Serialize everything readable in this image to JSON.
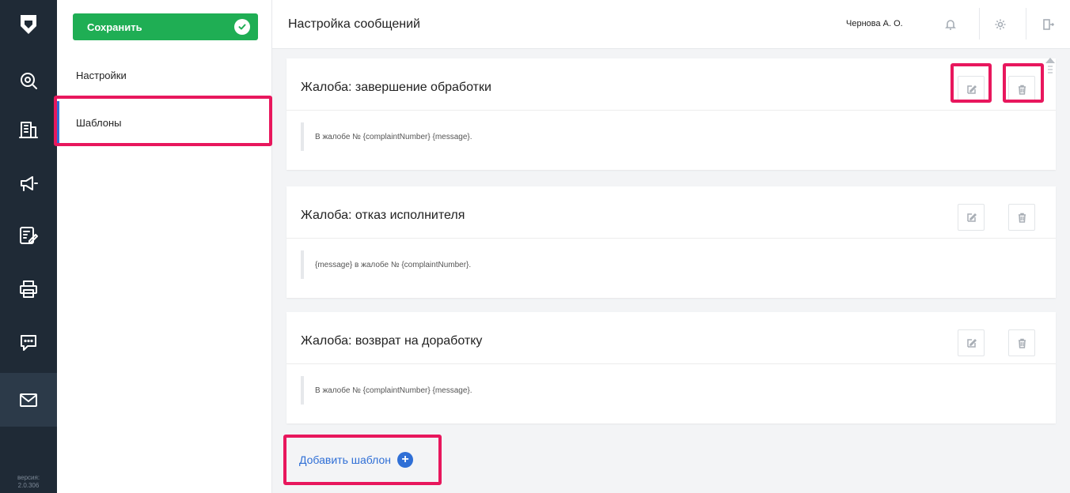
{
  "colors": {
    "rail_bg": "#1f2a36",
    "rail_active": "#2c3a49",
    "save_green": "#1fae54",
    "accent_blue": "#2f6fd6",
    "highlight": "#e8175d"
  },
  "rail": {
    "logo_icon": "shield-logo-icon",
    "items": [
      {
        "icon": "search-icon"
      },
      {
        "icon": "building-icon"
      },
      {
        "icon": "megaphone-icon"
      },
      {
        "icon": "edit-list-icon"
      },
      {
        "icon": "printer-icon"
      },
      {
        "icon": "chat-icon"
      },
      {
        "icon": "mail-icon",
        "active": true
      }
    ],
    "version_label": "версия:",
    "version_number": "2.0.306"
  },
  "sidebar": {
    "save_label": "Сохранить",
    "items": [
      {
        "label": "Настройки"
      },
      {
        "label": "Шаблоны",
        "active": true
      }
    ]
  },
  "header": {
    "title": "Настройка сообщений",
    "user_name": "Чернова А. О.",
    "icons": [
      "bell-icon",
      "gear-icon",
      "logout-icon"
    ]
  },
  "templates": [
    {
      "title": "Жалоба: завершение обработки",
      "text": "В жалобе № {complaintNumber} {message}."
    },
    {
      "title": "Жалоба: отказ исполнителя",
      "text": "{message} в жалобе № {complaintNumber}."
    },
    {
      "title": "Жалоба: возврат на доработку",
      "text": "В жалобе № {complaintNumber} {message}."
    }
  ],
  "add_template_label": "Добавить шаблон"
}
